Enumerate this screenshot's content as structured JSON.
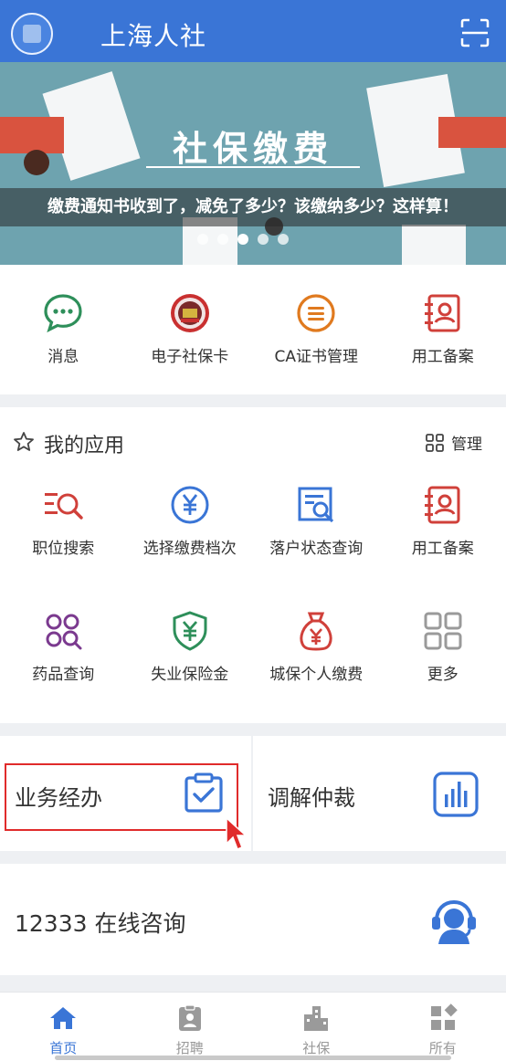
{
  "header": {
    "title": "上海人社"
  },
  "banner": {
    "title": "社保缴费",
    "subtitle": "缴费通知书收到了，减免了多少？该缴纳多少？这样算！"
  },
  "quick_links": [
    {
      "label": "消息",
      "icon": "message-icon"
    },
    {
      "label": "电子社保卡",
      "icon": "social-security-card-icon"
    },
    {
      "label": "CA证书管理",
      "icon": "ca-certificate-icon"
    },
    {
      "label": "用工备案",
      "icon": "employment-record-icon"
    }
  ],
  "my_apps": {
    "title": "我的应用",
    "manage_label": "管理",
    "items": [
      {
        "label": "职位搜索",
        "icon": "job-search-icon"
      },
      {
        "label": "选择缴费档次",
        "icon": "payment-level-icon"
      },
      {
        "label": "落户状态查询",
        "icon": "residency-status-icon"
      },
      {
        "label": "用工备案",
        "icon": "employment-record-icon"
      },
      {
        "label": "药品查询",
        "icon": "drug-query-icon"
      },
      {
        "label": "失业保险金",
        "icon": "unemployment-insurance-icon"
      },
      {
        "label": "城保个人缴费",
        "icon": "personal-payment-icon"
      },
      {
        "label": "更多",
        "icon": "more-icon"
      }
    ]
  },
  "business": {
    "left_label": "业务经办",
    "right_label": "调解仲裁"
  },
  "consult": {
    "label": "12333 在线咨询"
  },
  "tabs": [
    {
      "label": "首页",
      "icon": "home-icon",
      "active": true
    },
    {
      "label": "招聘",
      "icon": "recruit-icon",
      "active": false
    },
    {
      "label": "社保",
      "icon": "social-insurance-icon",
      "active": false
    },
    {
      "label": "所有",
      "icon": "all-apps-icon",
      "active": false
    }
  ],
  "colors": {
    "primary": "#3a75d6",
    "highlight": "#e02b2b",
    "green": "#2e8f5a",
    "orange": "#e07a1f",
    "red": "#d0403a",
    "purple": "#7b3a8f"
  }
}
